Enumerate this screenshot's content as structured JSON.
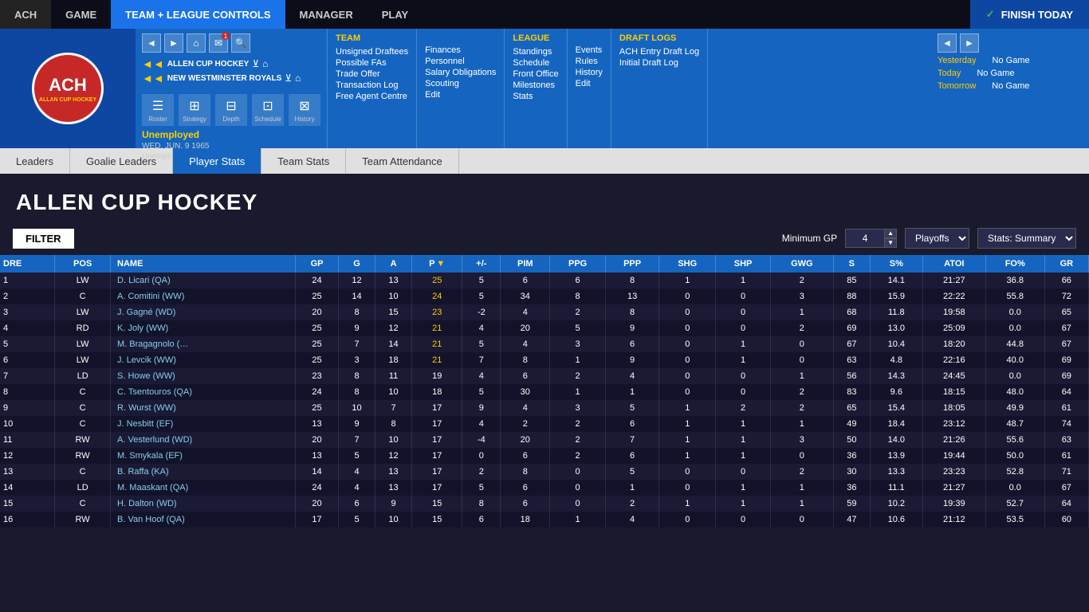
{
  "topNav": {
    "items": [
      "ACH",
      "GAME",
      "TEAM + LEAGUE CONTROLS",
      "MANAGER",
      "PLAY"
    ],
    "activeItem": "TEAM + LEAGUE CONTROLS",
    "finishToday": "FINISH TODAY"
  },
  "secondaryNav": {
    "logo": {
      "main": "ACH",
      "sub": "ALLAN CUP HOCKEY"
    },
    "userStatus": "Unemployed",
    "userDate": "WED. JUN. 9 1965",
    "userLabel": "Unemployed",
    "teamName": "ALLEN CUP HOCKEY",
    "teamSubName": "NEW WESTMINSTER ROYALS",
    "icons": [
      {
        "label": "Roster",
        "symbol": "☰"
      },
      {
        "label": "Strategy",
        "symbol": "⊞"
      },
      {
        "label": "Depth",
        "symbol": "⊟"
      },
      {
        "label": "Schedule",
        "symbol": "⊡"
      },
      {
        "label": "History",
        "symbol": "⊠"
      }
    ],
    "teamSection": {
      "title": "TEAM",
      "links": [
        "Unsigned Draftees",
        "Possible FAs",
        "Trade Offer",
        "Transaction Log",
        "Free Agent Centre"
      ]
    },
    "financeSection": {
      "links": [
        "Finances",
        "Personnel",
        "Salary Obligations",
        "Scouting",
        "Edit"
      ]
    },
    "leagueSection": {
      "title": "LEAGUE",
      "links": [
        "Standings",
        "Schedule",
        "Front Office",
        "Milestones",
        "Stats"
      ]
    },
    "eventsSection": {
      "links": [
        "Events",
        "Rules",
        "History",
        "Edit"
      ]
    },
    "draftSection": {
      "title": "DRAFT LOGS",
      "links": [
        "ACH Entry Draft Log",
        "Initial Draft Log"
      ]
    },
    "rightPanel": {
      "yesterday": "No Game",
      "today": "No Game",
      "tomorrow": "No Game"
    }
  },
  "subTabs": {
    "tabs": [
      "Leaders",
      "Goalie Leaders",
      "Player Stats",
      "Team Stats",
      "Team Attendance"
    ],
    "activeTab": "Player Stats"
  },
  "pageTitle": "ALLEN CUP HOCKEY",
  "filterBar": {
    "filterLabel": "FILTER",
    "minGpLabel": "Minimum GP",
    "minGpValue": "4",
    "playoffOption": "Playoffs",
    "statsOption": "Stats: Summary"
  },
  "tableHeaders": [
    {
      "key": "dre",
      "label": "DRE"
    },
    {
      "key": "pos",
      "label": "POS"
    },
    {
      "key": "name",
      "label": "NAME"
    },
    {
      "key": "gp",
      "label": "GP"
    },
    {
      "key": "g",
      "label": "G"
    },
    {
      "key": "a",
      "label": "A"
    },
    {
      "key": "p",
      "label": "P",
      "sorted": true,
      "dir": "desc"
    },
    {
      "key": "plusminus",
      "label": "+/-"
    },
    {
      "key": "pim",
      "label": "PIM"
    },
    {
      "key": "ppg",
      "label": "PPG"
    },
    {
      "key": "ppp",
      "label": "PPP"
    },
    {
      "key": "shg",
      "label": "SHG"
    },
    {
      "key": "shp",
      "label": "SHP"
    },
    {
      "key": "gwg",
      "label": "GWG"
    },
    {
      "key": "s",
      "label": "S"
    },
    {
      "key": "spct",
      "label": "S%"
    },
    {
      "key": "atoi",
      "label": "ATOI"
    },
    {
      "key": "fopct",
      "label": "FO%"
    },
    {
      "key": "gr",
      "label": "GR"
    }
  ],
  "tableRows": [
    {
      "dre": "1",
      "pos": "LW",
      "name": "D. Licari (QA)",
      "gp": "24",
      "g": "12",
      "a": "13",
      "p": "25",
      "plusminus": "5",
      "pim": "6",
      "ppg": "6",
      "ppp": "8",
      "shg": "1",
      "shp": "1",
      "gwg": "2",
      "s": "85",
      "spct": "14.1",
      "atoi": "21:27",
      "fopct": "36.8",
      "gr": "66"
    },
    {
      "dre": "2",
      "pos": "C",
      "name": "A. Comitini (WW)",
      "gp": "25",
      "g": "14",
      "a": "10",
      "p": "24",
      "plusminus": "5",
      "pim": "34",
      "ppg": "8",
      "ppp": "13",
      "shg": "0",
      "shp": "0",
      "gwg": "3",
      "s": "88",
      "spct": "15.9",
      "atoi": "22:22",
      "fopct": "55.8",
      "gr": "72"
    },
    {
      "dre": "3",
      "pos": "LW",
      "name": "J. Gagné (WD)",
      "gp": "20",
      "g": "8",
      "a": "15",
      "p": "23",
      "plusminus": "-2",
      "pim": "4",
      "ppg": "2",
      "ppp": "8",
      "shg": "0",
      "shp": "0",
      "gwg": "1",
      "s": "68",
      "spct": "11.8",
      "atoi": "19:58",
      "fopct": "0.0",
      "gr": "65"
    },
    {
      "dre": "4",
      "pos": "RD",
      "name": "K. Joly (WW)",
      "gp": "25",
      "g": "9",
      "a": "12",
      "p": "21",
      "plusminus": "4",
      "pim": "20",
      "ppg": "5",
      "ppp": "9",
      "shg": "0",
      "shp": "0",
      "gwg": "2",
      "s": "69",
      "spct": "13.0",
      "atoi": "25:09",
      "fopct": "0.0",
      "gr": "67"
    },
    {
      "dre": "5",
      "pos": "LW",
      "name": "M. Bragagnolo (…",
      "gp": "25",
      "g": "7",
      "a": "14",
      "p": "21",
      "plusminus": "5",
      "pim": "4",
      "ppg": "3",
      "ppp": "6",
      "shg": "0",
      "shp": "1",
      "gwg": "0",
      "s": "67",
      "spct": "10.4",
      "atoi": "18:20",
      "fopct": "44.8",
      "gr": "67"
    },
    {
      "dre": "6",
      "pos": "LW",
      "name": "J. Levcik (WW)",
      "gp": "25",
      "g": "3",
      "a": "18",
      "p": "21",
      "plusminus": "7",
      "pim": "8",
      "ppg": "1",
      "ppp": "9",
      "shg": "0",
      "shp": "1",
      "gwg": "0",
      "s": "63",
      "spct": "4.8",
      "atoi": "22:16",
      "fopct": "40.0",
      "gr": "69"
    },
    {
      "dre": "7",
      "pos": "LD",
      "name": "S. Howe (WW)",
      "gp": "23",
      "g": "8",
      "a": "11",
      "p": "19",
      "plusminus": "4",
      "pim": "6",
      "ppg": "2",
      "ppp": "4",
      "shg": "0",
      "shp": "0",
      "gwg": "1",
      "s": "56",
      "spct": "14.3",
      "atoi": "24:45",
      "fopct": "0.0",
      "gr": "69"
    },
    {
      "dre": "8",
      "pos": "C",
      "name": "C. Tsentouros (QA)",
      "gp": "24",
      "g": "8",
      "a": "10",
      "p": "18",
      "plusminus": "5",
      "pim": "30",
      "ppg": "1",
      "ppp": "1",
      "shg": "0",
      "shp": "0",
      "gwg": "2",
      "s": "83",
      "spct": "9.6",
      "atoi": "18:15",
      "fopct": "48.0",
      "gr": "64"
    },
    {
      "dre": "9",
      "pos": "C",
      "name": "R. Wurst (WW)",
      "gp": "25",
      "g": "10",
      "a": "7",
      "p": "17",
      "plusminus": "9",
      "pim": "4",
      "ppg": "3",
      "ppp": "5",
      "shg": "1",
      "shp": "2",
      "gwg": "2",
      "s": "65",
      "spct": "15.4",
      "atoi": "18:05",
      "fopct": "49.9",
      "gr": "61"
    },
    {
      "dre": "10",
      "pos": "C",
      "name": "J. Nesbitt (EF)",
      "gp": "13",
      "g": "9",
      "a": "8",
      "p": "17",
      "plusminus": "4",
      "pim": "2",
      "ppg": "2",
      "ppp": "6",
      "shg": "1",
      "shp": "1",
      "gwg": "1",
      "s": "49",
      "spct": "18.4",
      "atoi": "23:12",
      "fopct": "48.7",
      "gr": "74"
    },
    {
      "dre": "11",
      "pos": "RW",
      "name": "A. Vesterlund (WD)",
      "gp": "20",
      "g": "7",
      "a": "10",
      "p": "17",
      "plusminus": "-4",
      "pim": "20",
      "ppg": "2",
      "ppp": "7",
      "shg": "1",
      "shp": "1",
      "gwg": "3",
      "s": "50",
      "spct": "14.0",
      "atoi": "21:26",
      "fopct": "55.6",
      "gr": "63"
    },
    {
      "dre": "12",
      "pos": "RW",
      "name": "M. Smykala (EF)",
      "gp": "13",
      "g": "5",
      "a": "12",
      "p": "17",
      "plusminus": "0",
      "pim": "6",
      "ppg": "2",
      "ppp": "6",
      "shg": "1",
      "shp": "1",
      "gwg": "0",
      "s": "36",
      "spct": "13.9",
      "atoi": "19:44",
      "fopct": "50.0",
      "gr": "61"
    },
    {
      "dre": "13",
      "pos": "C",
      "name": "B. Raffa (KA)",
      "gp": "14",
      "g": "4",
      "a": "13",
      "p": "17",
      "plusminus": "2",
      "pim": "8",
      "ppg": "0",
      "ppp": "5",
      "shg": "0",
      "shp": "0",
      "gwg": "2",
      "s": "30",
      "spct": "13.3",
      "atoi": "23:23",
      "fopct": "52.8",
      "gr": "71"
    },
    {
      "dre": "14",
      "pos": "LD",
      "name": "M. Maaskant (QA)",
      "gp": "24",
      "g": "4",
      "a": "13",
      "p": "17",
      "plusminus": "5",
      "pim": "6",
      "ppg": "0",
      "ppp": "1",
      "shg": "0",
      "shp": "1",
      "gwg": "1",
      "s": "36",
      "spct": "11.1",
      "atoi": "21:27",
      "fopct": "0.0",
      "gr": "67"
    },
    {
      "dre": "15",
      "pos": "C",
      "name": "H. Dalton (WD)",
      "gp": "20",
      "g": "6",
      "a": "9",
      "p": "15",
      "plusminus": "8",
      "pim": "6",
      "ppg": "0",
      "ppp": "2",
      "shg": "1",
      "shp": "1",
      "gwg": "1",
      "s": "59",
      "spct": "10.2",
      "atoi": "19:39",
      "fopct": "52.7",
      "gr": "64"
    },
    {
      "dre": "16",
      "pos": "RW",
      "name": "B. Van Hoof (QA)",
      "gp": "17",
      "g": "5",
      "a": "10",
      "p": "15",
      "plusminus": "6",
      "pim": "18",
      "ppg": "1",
      "ppp": "4",
      "shg": "0",
      "shp": "0",
      "gwg": "0",
      "s": "47",
      "spct": "10.6",
      "atoi": "21:12",
      "fopct": "53.5",
      "gr": "60"
    }
  ]
}
